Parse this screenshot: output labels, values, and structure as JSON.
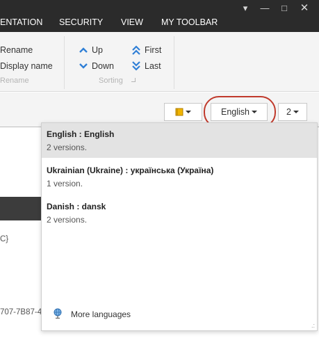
{
  "window": {
    "controls": [
      "▾",
      "—",
      "□",
      "✕"
    ]
  },
  "ribbon_tabs": [
    "ENTATION",
    "SECURITY",
    "VIEW",
    "MY TOOLBAR"
  ],
  "ribbon": {
    "rename_group": {
      "items": [
        "Rename",
        "Display name"
      ],
      "label": "Rename"
    },
    "sorting_group": {
      "up": "Up",
      "down": "Down",
      "first": "First",
      "last": "Last",
      "label": "Sorting"
    }
  },
  "toolbar": {
    "language_button": "English",
    "version_button": "2"
  },
  "background": {
    "text_1": "C}",
    "text_2": "707-7B87-4"
  },
  "language_menu": {
    "items": [
      {
        "name": "English : English",
        "versions": "2 versions.",
        "selected": true
      },
      {
        "name": "Ukrainian (Ukraine) : українська (Україна)",
        "versions": "1 version.",
        "selected": false
      },
      {
        "name": "Danish : dansk",
        "versions": "2 versions.",
        "selected": false
      }
    ],
    "more_languages": "More languages"
  },
  "colors": {
    "titlebar": "#2b2b2b",
    "ribbon": "#f4f4f4",
    "accent_blue": "#2f7fd6",
    "highlight_ring": "#c0392b",
    "selected_row": "#e3e3e3"
  },
  "icons": {
    "window": [
      "dropdown-icon",
      "minimize-icon",
      "maximize-icon",
      "close-icon"
    ],
    "sorting": [
      "chevron-up-icon",
      "chevron-down-icon",
      "double-chevron-up-icon",
      "double-chevron-down-icon"
    ],
    "toolbar": "book-icon",
    "menu": "globe-icon"
  }
}
